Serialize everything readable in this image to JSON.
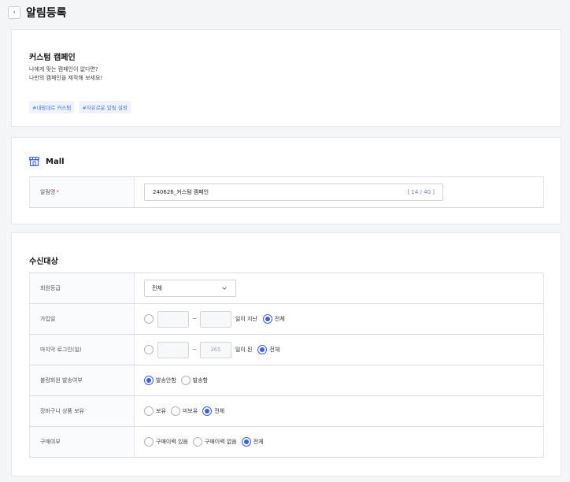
{
  "header": {
    "title": "알림등록",
    "back_icon": "chevron-left-icon"
  },
  "custom_campaign": {
    "title": "커스텀 캠페인",
    "desc_line1": "나에게 맞는 캠페인이 없다면?",
    "desc_line2": "나만의 캠페인을 제작해 보세요!",
    "tags": [
      "#내맘대로 커스텀",
      "#자유로운 알림 설정"
    ]
  },
  "mall": {
    "label": "Mall",
    "icon": "store-icon",
    "name_label": "알림명",
    "required_mark": "*",
    "name_value": "240626_커스텀 캠페인",
    "counter": "[ 14 / 40 ]"
  },
  "target": {
    "section_title": "수신대상",
    "grade": {
      "label": "회원등급",
      "selected": "전체"
    },
    "join_date": {
      "label": "가입일",
      "from": "",
      "to": "",
      "suffix": "일이 지난",
      "all": "전체",
      "selected": "all"
    },
    "last_login": {
      "label": "마지막 로그인(일)",
      "from": "",
      "to_placeholder": "365",
      "suffix": "일이 된",
      "all": "전체",
      "selected": "all"
    },
    "bad_member": {
      "label": "불량회원 발송여부",
      "opt1": "발송안함",
      "opt2": "발송함",
      "selected": "opt1"
    },
    "cart": {
      "label": "장바구니 상품 보유",
      "opt1": "보유",
      "opt2": "미보유",
      "opt3": "전체",
      "selected": "opt3"
    },
    "purchase": {
      "label": "구매여부",
      "opt1": "구매이력 있음",
      "opt2": "구매이력 없음",
      "opt3": "전체",
      "selected": "opt3"
    }
  },
  "colors": {
    "accent": "#3b5fe0",
    "tag_bg": "#eef3ff",
    "tag_text": "#4a74d9",
    "required": "#e43d3d"
  }
}
